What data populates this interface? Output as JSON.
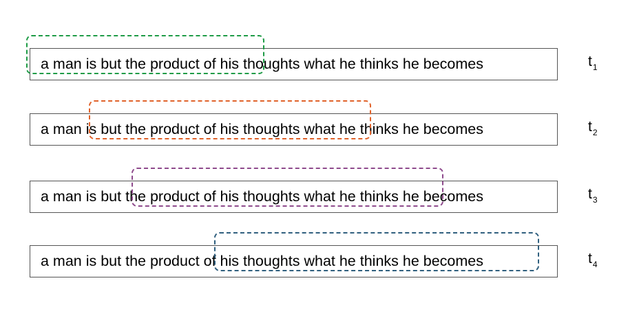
{
  "sentence": "a man is but the product of his thoughts what he thinks he becomes",
  "steps": [
    {
      "label": "t",
      "index": "1",
      "window_color": "#1e9b46"
    },
    {
      "label": "t",
      "index": "2",
      "window_color": "#e0622a"
    },
    {
      "label": "t",
      "index": "3",
      "window_color": "#8e4a8c"
    },
    {
      "label": "t",
      "index": "4",
      "window_color": "#2f5f7e"
    }
  ]
}
